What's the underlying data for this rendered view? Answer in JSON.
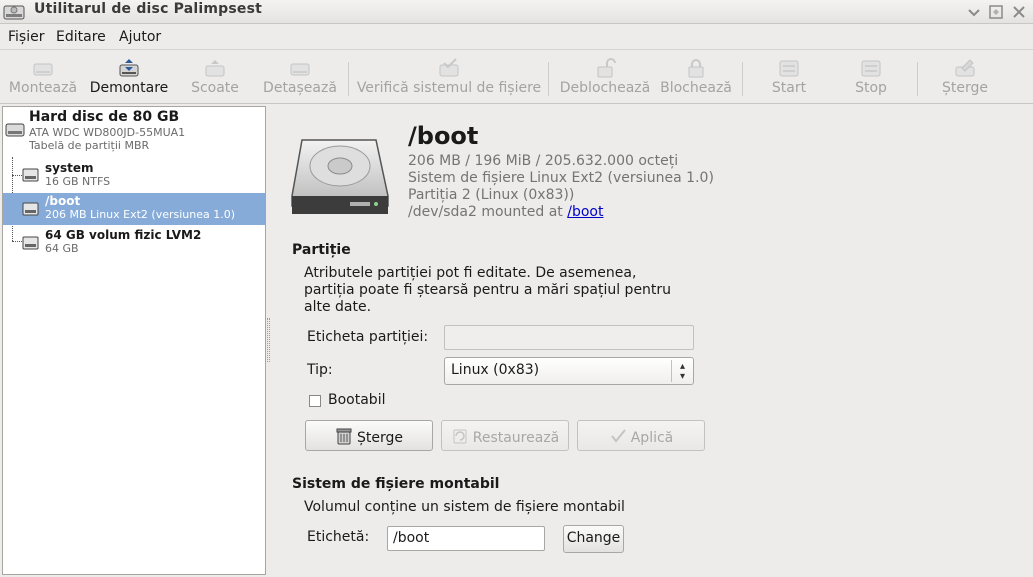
{
  "window": {
    "title": "Utilitarul de disc Palimpsest"
  },
  "menu": {
    "items": [
      {
        "label": "Fișier"
      },
      {
        "label": "Editare"
      },
      {
        "label": "Ajutor"
      }
    ]
  },
  "toolbar": {
    "buttons": [
      {
        "label": "Montează",
        "icon": "mount-icon",
        "enabled": false
      },
      {
        "label": "Demontare",
        "icon": "unmount-icon",
        "enabled": true
      },
      {
        "label": "Scoate",
        "icon": "eject-icon",
        "enabled": false
      },
      {
        "label": "Detașează",
        "icon": "detach-icon",
        "enabled": false
      },
      {
        "label": "Verifică sistemul de fișiere",
        "icon": "check-filesystem-icon",
        "enabled": false
      },
      {
        "label": "Deblochează",
        "icon": "unlock-icon",
        "enabled": false
      },
      {
        "label": "Blochează",
        "icon": "lock-icon",
        "enabled": false
      },
      {
        "label": "Start",
        "icon": "start-icon",
        "enabled": false
      },
      {
        "label": "Stop",
        "icon": "stop-icon",
        "enabled": false
      },
      {
        "label": "Șterge",
        "icon": "erase-icon",
        "enabled": false
      }
    ]
  },
  "tree": {
    "disk": {
      "name": "Hard disc de 80 GB",
      "model": "ATA WDC WD800JD-55MUA1",
      "table": "Tabelă de partiții MBR"
    },
    "volumes": [
      {
        "name": "system",
        "desc": "16 GB NTFS",
        "selected": false
      },
      {
        "name": "/boot",
        "desc": "206 MB Linux Ext2 (versiunea 1.0)",
        "selected": true
      },
      {
        "name": "64 GB volum fizic LVM2",
        "desc": "64 GB",
        "selected": false
      }
    ]
  },
  "detail": {
    "title": "/boot",
    "size": "206 MB / 196 MiB / 205.632.000 octeți",
    "fs": "Sistem de fișiere Linux Ext2 (versiunea 1.0)",
    "partition": "Partiția 2 (Linux (0x83))",
    "mounted_prefix": "/dev/sda2 mounted at",
    "mounted_link": "/boot"
  },
  "partition_section": {
    "heading": "Partiție",
    "description": "Atributele partiției pot fi editate. De asemenea, partiția poate fi ștearsă pentru a mări spațiul pentru alte date.",
    "label_caption": "Eticheta partiției:",
    "label_value": "",
    "type_caption": "Tip:",
    "type_value": "Linux (0x83)",
    "bootable_caption": "Bootabil",
    "bootable_checked": false,
    "delete_label": "Șterge",
    "revert_label": "Restaurează",
    "apply_label": "Aplică"
  },
  "fs_section": {
    "heading": "Sistem de fișiere montabil",
    "description": "Volumul conține un sistem de fișiere montabil",
    "label_caption": "Etichetă:",
    "label_value": "/boot",
    "change_label": "Change"
  },
  "colors": {
    "selection": "#86abd9",
    "link": "#0000cc",
    "disabled_text": "#a4a3a1"
  }
}
